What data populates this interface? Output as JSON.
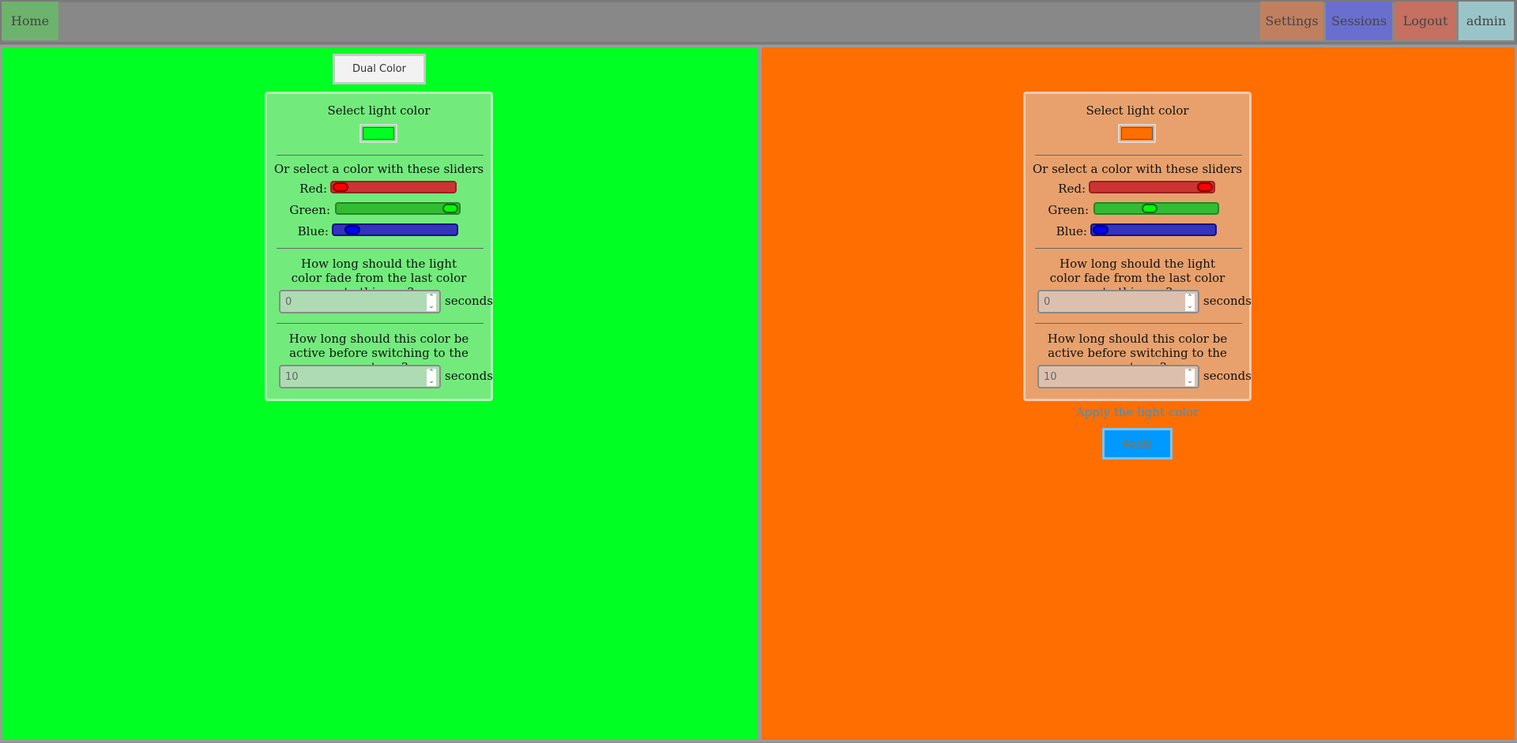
{
  "nav": {
    "home": "Home",
    "settings": "Settings",
    "sessions": "Sessions",
    "logout": "Logout",
    "user": "admin"
  },
  "mode_button": "Dual Color",
  "panels": [
    {
      "background": "#00ff22",
      "select_label": "Select light color",
      "swatch_color": "#00ff22",
      "slider_heading": "Or select a color with these sliders",
      "red_label": "Red:",
      "green_label": "Green:",
      "blue_label": "Blue:",
      "red_value": 0,
      "green_value": 255,
      "blue_value": 34,
      "fade_question": "How long should the light color fade from the last color to this one?",
      "fade_value": "0",
      "active_question": "How long should this color be active before switching to the next one?",
      "active_value": "10",
      "unit": "seconds"
    },
    {
      "background": "#ff6e00",
      "select_label": "Select light color",
      "swatch_color": "#ff6e00",
      "slider_heading": "Or select a color with these sliders",
      "red_label": "Red:",
      "green_label": "Green:",
      "blue_label": "Blue:",
      "red_value": 255,
      "green_value": 110,
      "blue_value": 0,
      "fade_question": "How long should the light color fade from the last color to this one?",
      "fade_value": "0",
      "active_question": "How long should this color be active before switching to the next one?",
      "active_value": "10",
      "unit": "seconds"
    }
  ],
  "apply": {
    "label": "Apply the light color",
    "button": "Apply"
  },
  "colors": {
    "topbar": "#888888",
    "apply_button": "#0099ff"
  }
}
